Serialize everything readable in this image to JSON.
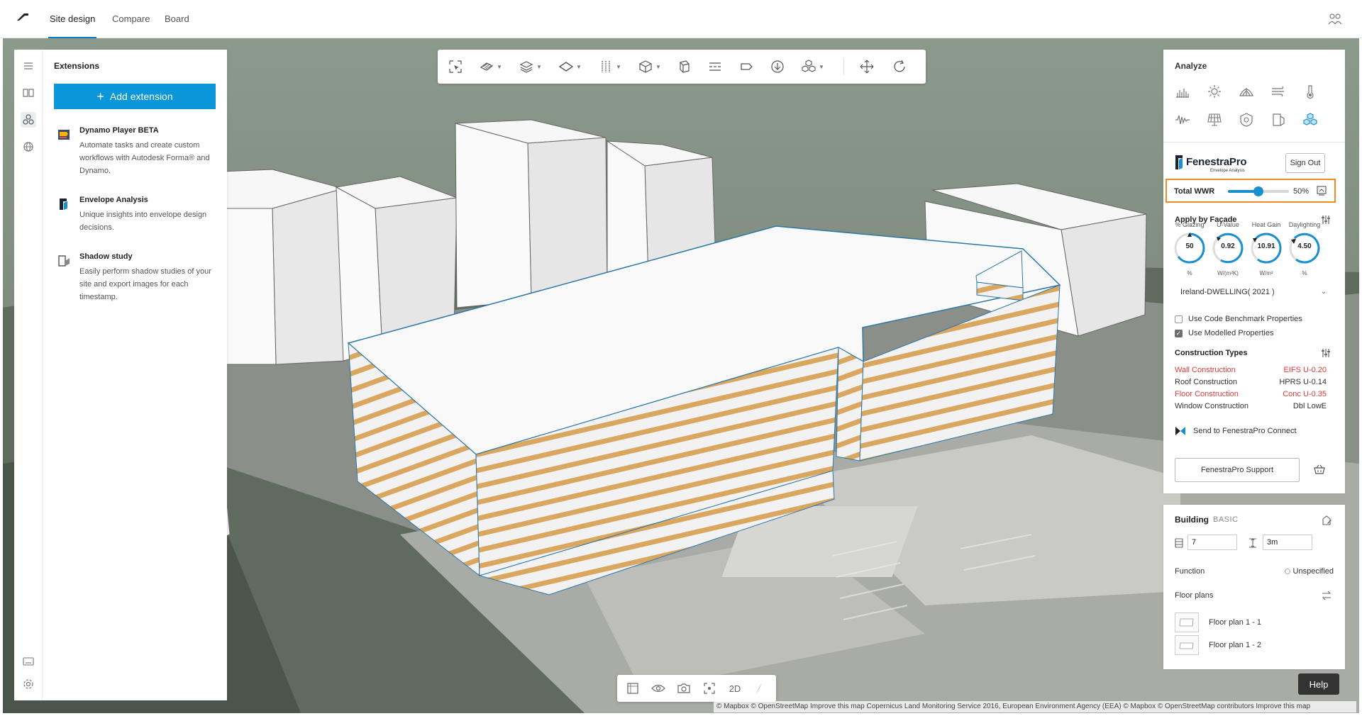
{
  "nav": {
    "tabs": [
      {
        "label": "Site design",
        "active": true
      },
      {
        "label": "Compare",
        "active": false
      },
      {
        "label": "Board",
        "active": false
      }
    ]
  },
  "extensions": {
    "title": "Extensions",
    "add_label": "Add extension",
    "items": [
      {
        "name": "Dynamo Player BETA",
        "desc": "Automate tasks and create custom workflows with Autodesk Forma® and Dynamo."
      },
      {
        "name": "Envelope Analysis",
        "desc": "Unique insights into envelope design decisions."
      },
      {
        "name": "Shadow study",
        "desc": "Easily perform shadow studies of your site and export images for each timestamp."
      }
    ]
  },
  "bottom_toolbar": {
    "mode_2d": "2D"
  },
  "attribution": "© Mapbox © OpenStreetMap Improve this map Copernicus Land Monitoring Service 2016, European Environment Agency (EEA) © Mapbox © OpenStreetMap contributors Improve this map",
  "help_label": "Help",
  "analyze": {
    "title": "Analyze",
    "icons": [
      "bar-chart-icon",
      "sun-icon",
      "dome-icon",
      "wind-icon",
      "thermometer-icon",
      "wave-icon",
      "solar-panel-icon",
      "shield-icon",
      "door-icon",
      "cubes-icon"
    ]
  },
  "fenestra": {
    "brand": "FenestraPro",
    "brand_sub": "Envelope Analysis",
    "sign_out": "Sign Out",
    "wwr_label": "Total WWR",
    "wwr_value": "50%",
    "wwr_fraction": 0.5,
    "apply_title": "Apply by Façade",
    "dials": [
      {
        "label": "% Glazing",
        "value": "50",
        "unit": "%"
      },
      {
        "label": "U-Value",
        "value": "0.92",
        "unit": "W/(m²K)"
      },
      {
        "label": "Heat Gain",
        "value": "10.91",
        "unit": "W/m²"
      },
      {
        "label": "Daylighting",
        "value": "4.50",
        "unit": "%"
      }
    ],
    "standard": "Ireland-DWELLING( 2021 )",
    "use_code": "Use Code Benchmark Properties",
    "use_modelled": "Use Modelled Properties",
    "construction_title": "Construction Types",
    "constructions": [
      {
        "name": "Wall Construction",
        "value": "EIFS U-0.20",
        "warn": true
      },
      {
        "name": "Roof Construction",
        "value": "HPRS U-0.14",
        "warn": false
      },
      {
        "name": "Floor Construction",
        "value": "Conc U-0.35",
        "warn": true
      },
      {
        "name": "Window Construction",
        "value": "Dbl LowE",
        "warn": false
      }
    ],
    "send_label": "Send to FenestraPro Connect",
    "support_label": "FenestraPro Support",
    "warn_color": "#e03b3b",
    "accent_color": "#1a8fd0",
    "highlight_color": "#f08a24"
  },
  "building": {
    "title": "Building",
    "badge": "BASIC",
    "floors": "7",
    "height": "3m",
    "function_label": "Function",
    "function_value": "Unspecified",
    "floor_plans_label": "Floor plans",
    "floor_plans": [
      "Floor plan 1 - 1",
      "Floor plan 1 - 2"
    ]
  }
}
